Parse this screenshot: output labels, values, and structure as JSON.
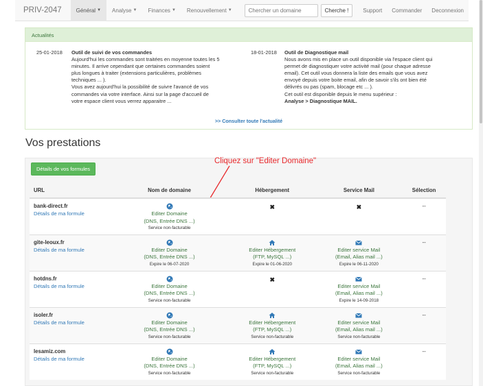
{
  "navbar": {
    "brand": "PRIV-2047",
    "menus": [
      {
        "label": "Général",
        "active": true
      },
      {
        "label": "Analyse",
        "active": false
      },
      {
        "label": "Finances",
        "active": false
      },
      {
        "label": "Renouvellement",
        "active": false
      }
    ],
    "search_placeholder": "Chercher un domaine",
    "search_button": "Cherche !",
    "right_links": [
      "Support",
      "Commander",
      "Deconnexion"
    ]
  },
  "news": {
    "header": "Actualités",
    "items": [
      {
        "date": "25-01-2018",
        "title": "Outil de suivi de vos commandes",
        "lines": [
          "Aujourd'hui les commandes sont traitées en moyenne toutes les 5",
          "minutes. Il arrive cependant que certaines commandes soient",
          "plus longues à traiter (extensions particulières, problèmes",
          "techniques ... ).",
          "Vous avez aujourd'hui la possibilité de suivre l'avancé de vos",
          "commandes via votre interface. Ainsi sur la page d'accueil de",
          "votre espace client vous verrez apparaitre ..."
        ]
      },
      {
        "date": "18-01-2018",
        "title": "Outil de Diagnostique mail",
        "lines": [
          "Nous avons mis en place un outil disponible via l'espace client qui",
          "permet de diagnostiquer votre activité mail (pour chaque adresse",
          "email). Cet outil vous donnera la liste des emails que vous avez",
          "envoyé depuis votre boite email, afin de savoir s'ils ont bien été",
          "délivrés ou pas (spam, blocage etc ... ).",
          "Cet outil est disponible depuis le menu supérieur :"
        ],
        "path": "Analyse > Diagnostique MAIL."
      }
    ],
    "more_link": ">> Consulter toute l'actualité"
  },
  "prestations": {
    "title": "Vos prestations",
    "details_button": "Détails de vos formules",
    "annotation": "Cliquez sur \"Editer Domaine\"",
    "columns": [
      "URL",
      "Nom de domaine",
      "Hébergement",
      "Service Mail",
      "Sélection"
    ],
    "detail_link": "Détails de ma formule",
    "rows": [
      {
        "url": "bank-direct.fr",
        "domaine": {
          "label": "Editer Domaine",
          "sub": "(DNS, Entrée DNS ...)",
          "note": "Service non-facturable"
        },
        "hebergement": null,
        "mail": null,
        "selection": "--"
      },
      {
        "url": "gite-leoux.fr",
        "domaine": {
          "label": "Editer Domaine",
          "sub": "(DNS, Entrée DNS ...)",
          "note": "Expire le 06-07-2020"
        },
        "hebergement": {
          "label": "Editer Hébergement",
          "sub": "(FTP, MySQL ...)",
          "note": "Expire le 01-06-2020"
        },
        "mail": {
          "label": "Editer service Mail",
          "sub": "(Email, Alias mail ...)",
          "note": "Expire le 06-11-2020"
        },
        "selection": "--"
      },
      {
        "url": "hotdns.fr",
        "domaine": {
          "label": "Editer Domaine",
          "sub": "(DNS, Entrée DNS ...)",
          "note": "Service non-facturable"
        },
        "hebergement": null,
        "mail": {
          "label": "Editer service Mail",
          "sub": "(Email, Alias mail ...)",
          "note": "Expire le 14-09-2018"
        },
        "selection": "--"
      },
      {
        "url": "isoler.fr",
        "domaine": {
          "label": "Editer Domaine",
          "sub": "(DNS, Entrée DNS ...)",
          "note": "Service non-facturable"
        },
        "hebergement": {
          "label": "Editer Hébergement",
          "sub": "(FTP, MySQL ...)",
          "note": "Service non-facturable"
        },
        "mail": {
          "label": "Editer service Mail",
          "sub": "(Email, Alias mail ...)",
          "note": "Service non-facturable"
        },
        "selection": "--"
      },
      {
        "url": "lesamiz.com",
        "domaine": {
          "label": "Editer Domaine",
          "sub": "(DNS, Entrée DNS ...)",
          "note": "Service non-facturable"
        },
        "hebergement": {
          "label": "Editer Hébergement",
          "sub": "(FTP, MySQL ...)",
          "note": "Service non-facturable"
        },
        "mail": {
          "label": "Editer service Mail",
          "sub": "(Email, Alias mail ...)",
          "note": "Service non-facturable"
        },
        "selection": "--"
      }
    ]
  },
  "colors": {
    "accent_green": "#5cb85c",
    "link_blue": "#337ab7",
    "text_green": "#3c763d",
    "annotation_red": "#e8292c"
  },
  "icons": {
    "domaine": "globe-icon",
    "hebergement": "home-icon",
    "mail": "envelope-icon",
    "absent": "cross-icon"
  }
}
